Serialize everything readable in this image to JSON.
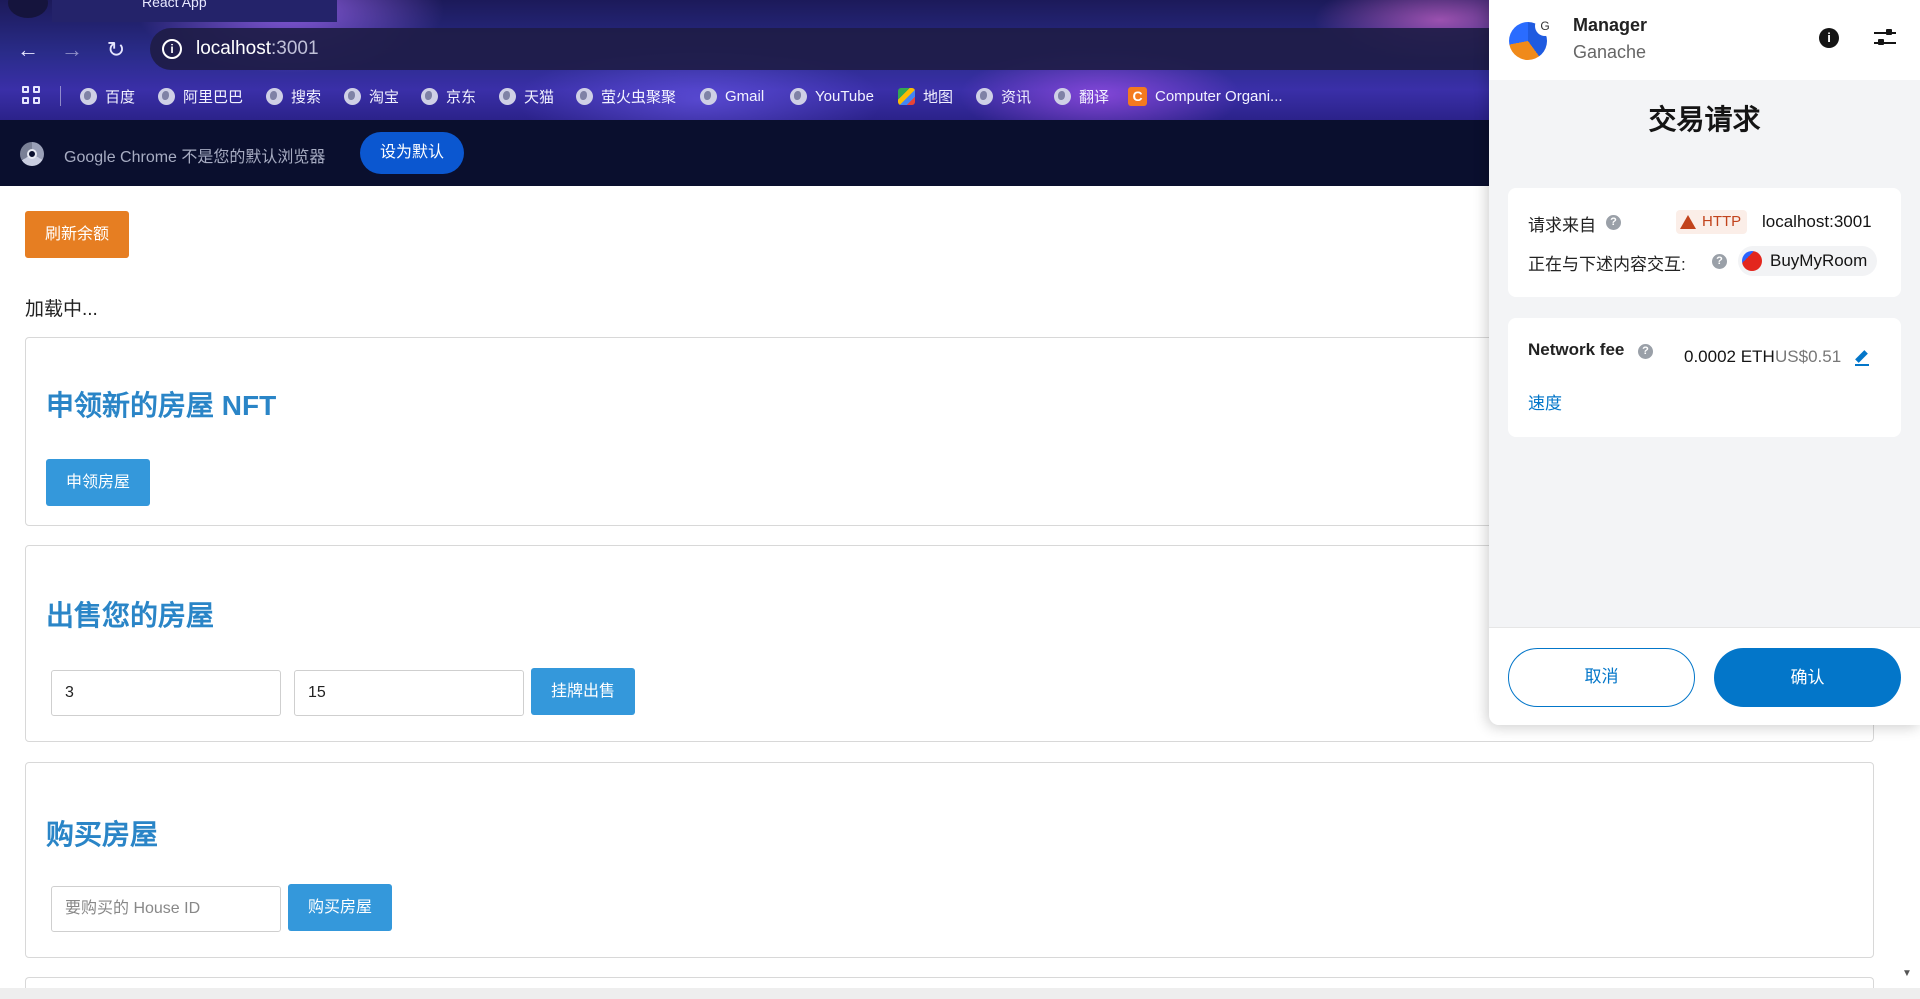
{
  "browser": {
    "tab_title": "React App",
    "url_host": "localhost",
    "url_port": ":3001",
    "bookmarks": [
      "百度",
      "阿里巴巴",
      "搜索",
      "淘宝",
      "京东",
      "天猫",
      "萤火虫聚聚",
      "Gmail",
      "YouTube",
      "地图",
      "资讯",
      "翻译",
      "Computer Organi..."
    ],
    "infobar_text": "Google Chrome 不是您的默认浏览器",
    "infobar_button": "设为默认"
  },
  "page": {
    "refresh_button": "刷新余额",
    "loading_text": "加载中...",
    "claim": {
      "title": "申领新的房屋 NFT",
      "button": "申领房屋"
    },
    "sell": {
      "title": "出售您的房屋",
      "input1_value": "3",
      "input2_value": "15",
      "button": "挂牌出售"
    },
    "buy": {
      "title": "购买房屋",
      "input_placeholder": "要购买的 House ID",
      "button": "购买房屋"
    }
  },
  "metamask": {
    "account_name": "Manager",
    "network": "Ganache",
    "avatar_badge": "G",
    "title": "交易请求",
    "request_from_label": "请求来自",
    "http_badge": "HTTP",
    "origin": "localhost:3001",
    "interacting_label": "正在与下述内容交互:",
    "contract_name": "BuyMyRoom",
    "network_fee_label": "Network fee",
    "fee_eth": "0.0002 ETH",
    "fee_usd": "US$0.51",
    "speed_label": "速度",
    "cancel_button": "取消",
    "confirm_button": "确认"
  },
  "colors": {
    "accent_orange": "#e67e22",
    "accent_blue": "#3498db",
    "metamask_blue": "#0376c9"
  }
}
